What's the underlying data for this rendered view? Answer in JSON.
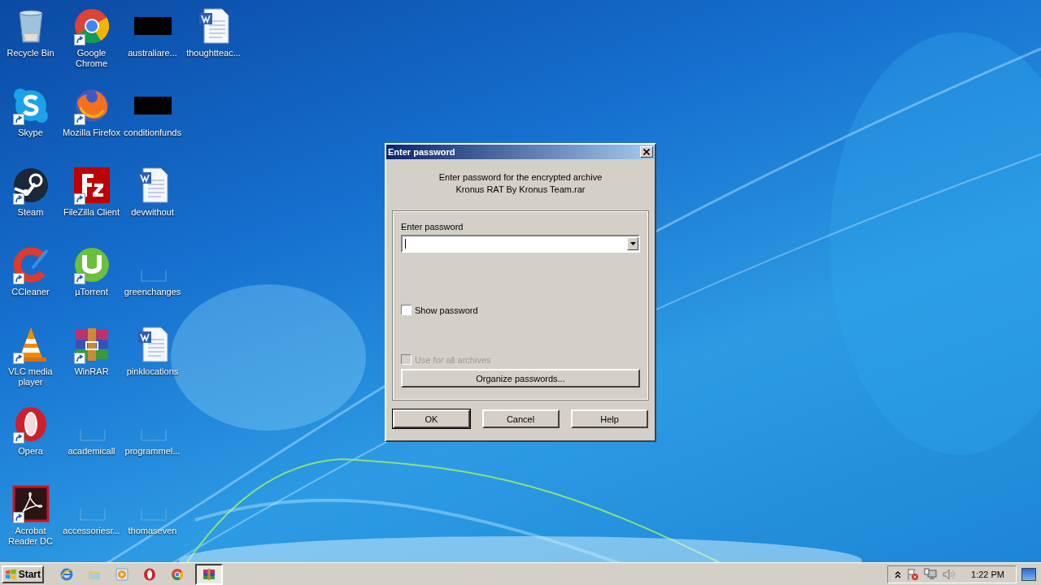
{
  "desktop": {
    "icon_columns": [
      [
        {
          "label": "Recycle Bin",
          "kind": "recycle",
          "shortcut": false
        },
        {
          "label": "Skype",
          "kind": "skype",
          "shortcut": true
        },
        {
          "label": "Steam",
          "kind": "steam",
          "shortcut": true
        },
        {
          "label": "CCleaner",
          "kind": "ccleaner",
          "shortcut": true
        },
        {
          "label": "VLC media player",
          "kind": "vlc",
          "shortcut": true
        },
        {
          "label": "Opera",
          "kind": "opera",
          "shortcut": true
        },
        {
          "label": "Acrobat Reader DC",
          "kind": "acrobat",
          "shortcut": true
        }
      ],
      [
        {
          "label": "Google Chrome",
          "kind": "chrome",
          "shortcut": true
        },
        {
          "label": "Mozilla Firefox",
          "kind": "firefox",
          "shortcut": true
        },
        {
          "label": "FileZilla Client",
          "kind": "filezilla",
          "shortcut": true
        },
        {
          "label": "µTorrent",
          "kind": "utorrent",
          "shortcut": true
        },
        {
          "label": "WinRAR",
          "kind": "winrar",
          "shortcut": true
        },
        {
          "label": "academicall",
          "kind": "blank",
          "shortcut": false
        },
        {
          "label": "accessoriesr...",
          "kind": "blank",
          "shortcut": false
        }
      ],
      [
        {
          "label": "australiare...",
          "kind": "redacted",
          "shortcut": false
        },
        {
          "label": "conditionfunds",
          "kind": "redacted",
          "shortcut": false
        },
        {
          "label": "devwithout",
          "kind": "word",
          "shortcut": false
        },
        {
          "label": "greenchanges",
          "kind": "blank",
          "shortcut": false
        },
        {
          "label": "pinklocations",
          "kind": "word",
          "shortcut": false
        },
        {
          "label": "programmel...",
          "kind": "blank",
          "shortcut": false
        },
        {
          "label": "thomaseven",
          "kind": "blank",
          "shortcut": false
        }
      ],
      [
        {
          "label": "thoughtteac...",
          "kind": "word",
          "shortcut": false
        }
      ]
    ]
  },
  "dialog": {
    "title": "Enter password",
    "message": [
      "Enter password for the encrypted archive",
      "Kronus RAT By Kronus Team.rar"
    ],
    "password_label": "Enter password",
    "options": [
      {
        "label": "Show password",
        "checked": false,
        "disabled": false
      },
      {
        "label": "Use for all archives",
        "checked": false,
        "disabled": true
      }
    ],
    "organize_button": "Organize passwords...",
    "buttons": [
      {
        "label": "OK",
        "default": true
      },
      {
        "label": "Cancel",
        "default": false
      },
      {
        "label": "Help",
        "default": false
      }
    ]
  },
  "taskbar": {
    "start": "Start",
    "items": [
      {
        "kind": "ie",
        "selected": false
      },
      {
        "kind": "explorer",
        "selected": false
      },
      {
        "kind": "media",
        "selected": false
      },
      {
        "kind": "opera",
        "selected": false
      },
      {
        "kind": "chrome",
        "selected": false
      },
      {
        "kind": "winrar",
        "selected": true
      }
    ],
    "clock": "1:22 PM"
  }
}
